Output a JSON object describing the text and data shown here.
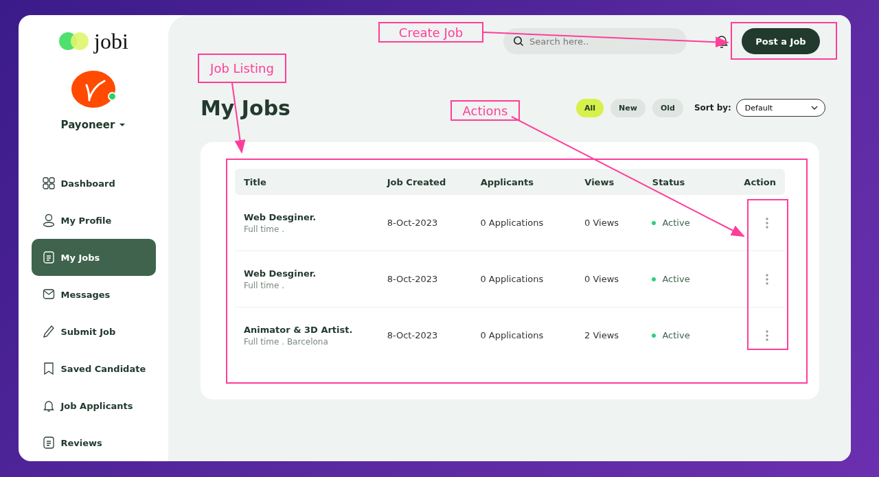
{
  "brand": {
    "name": "jobi"
  },
  "account": {
    "name": "Payoneer",
    "online": true
  },
  "sidebar": {
    "items": [
      {
        "label": "Dashboard",
        "kind": "grid",
        "selected": false
      },
      {
        "label": "My Profile",
        "kind": "user",
        "selected": false
      },
      {
        "label": "My Jobs",
        "kind": "doc",
        "selected": true
      },
      {
        "label": "Messages",
        "kind": "mail",
        "selected": false
      },
      {
        "label": "Submit Job",
        "kind": "pencil",
        "selected": false
      },
      {
        "label": "Saved Candidate",
        "kind": "bookmark",
        "selected": false
      },
      {
        "label": "Job Applicants",
        "kind": "bell",
        "selected": false
      },
      {
        "label": "Reviews",
        "kind": "doc",
        "selected": false
      }
    ]
  },
  "header": {
    "search": {
      "placeholder": "Search here.."
    },
    "post_button": "Post a Job"
  },
  "page": {
    "title": "My Jobs",
    "filters": [
      {
        "label": "All",
        "selected": true
      },
      {
        "label": "New",
        "selected": false
      },
      {
        "label": "Old",
        "selected": false
      }
    ],
    "sort": {
      "label": "Sort by:",
      "value": "Default"
    }
  },
  "table": {
    "columns": [
      "Title",
      "Job Created",
      "Applicants",
      "Views",
      "Status",
      "Action"
    ],
    "rows": [
      {
        "title": "Web Desginer.",
        "subtitle": "Full time .",
        "created": "8-Oct-2023",
        "applicants": "0 Applications",
        "views": "0 Views",
        "status": "Active"
      },
      {
        "title": "Web Desginer.",
        "subtitle": "Full time .",
        "created": "8-Oct-2023",
        "applicants": "0 Applications",
        "views": "0 Views",
        "status": "Active"
      },
      {
        "title": "Animator & 3D Artist.",
        "subtitle": "Full time . Barcelona",
        "created": "8-Oct-2023",
        "applicants": "0 Applications",
        "views": "2 Views",
        "status": "Active"
      }
    ]
  },
  "annotations": [
    "Create Job",
    "Job Listing",
    "Actions"
  ]
}
